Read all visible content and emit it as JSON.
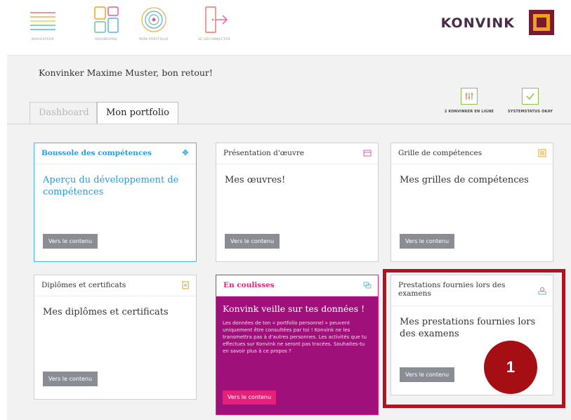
{
  "nav": {
    "items": [
      {
        "label": "NAVIGATEUR",
        "icon": "menu-lines-icon"
      },
      {
        "label": "DASHBOARD",
        "icon": "dashboard-grid-icon"
      },
      {
        "label": "MON PORTFOLIO",
        "icon": "portfolio-rings-icon"
      },
      {
        "label": "SE DÉCONNECTER",
        "icon": "logout-door-icon"
      }
    ],
    "brand": "KONVINK"
  },
  "welcome": "Konvinker Maxime Muster, bon retour!",
  "tabs": [
    {
      "label": "Dashboard",
      "active": false
    },
    {
      "label": "Mon portfolio",
      "active": true
    }
  ],
  "status": {
    "online": "2 KONVINKER EN LIGNE",
    "system": "SYSTEMSTATUS OKAY"
  },
  "cards": [
    {
      "title": "Boussole des compétences",
      "body": "Aperçu du développement de compétences",
      "button": "Vers le contenu",
      "icon": "compass-icon"
    },
    {
      "title": "Présentation d'œuvre",
      "body": "Mes œuvres!",
      "button": "Vers le contenu",
      "icon": "box-icon"
    },
    {
      "title": "Grille de compétences",
      "body": "Mes grilles de compétences",
      "button": "Vers le contenu",
      "icon": "grid-icon"
    },
    {
      "title": "Diplômes et certificats",
      "body": "Mes diplômes et certificats",
      "button": "Vers le contenu",
      "icon": "document-icon"
    },
    {
      "title": "En coulisses",
      "body_title": "Konvink veille sur tes données !",
      "body": "Les données de ton « portfolio personnel » peuvent uniquement être consultées par toi ! Konvink ne les transmettra pas à d'autres personnes. Les activités que tu effectues sur Konvink ne seront pas tracées. Souhaites-tu en savoir plus à ce propos ?",
      "button": "Vers le contenu",
      "icon": "chat-bubbles-icon"
    },
    {
      "title": "Prestations fournies lors des examens",
      "body": "Mes prestations fournies lors des examens",
      "button": "Vers le contenu",
      "icon": "exam-icon"
    }
  ],
  "annotation": {
    "badge": "1"
  },
  "colors": {
    "blue": "#4ab4e6",
    "magenta": "#e3207a",
    "purple": "#a0107a",
    "highlight": "#b0141c",
    "status_green": "#8bc34a"
  }
}
